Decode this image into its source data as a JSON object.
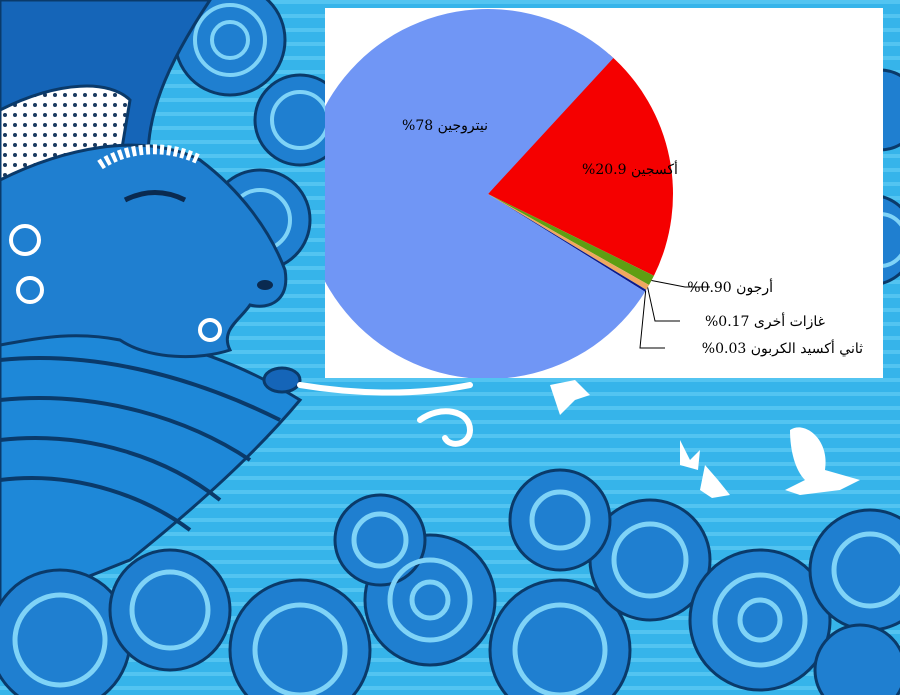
{
  "background": {
    "description_icon": "wind-god-blowing-over-waves-illustration",
    "colors": {
      "sky": "#2fa7e0",
      "deep": "#0b5fa8",
      "face": "#1f7fd0",
      "foam": "#ffffff"
    }
  },
  "chart_data": {
    "type": "pie",
    "title": "",
    "slices": [
      {
        "label": "نيتروجين 78%",
        "value": 78.0,
        "color": "#7096f5"
      },
      {
        "label": "أكسجين 20.9%",
        "value": 20.9,
        "color": "#f50000"
      },
      {
        "label": "أرجون 0.90%",
        "value": 0.9,
        "color": "#5f9e12"
      },
      {
        "label": "غازات أخرى 0.17%",
        "value": 0.17,
        "color": "#f0a860"
      },
      {
        "label": "ثاني أكسيد الكربون 0.03%",
        "value": 0.03,
        "color": "#0a1a8c"
      }
    ]
  }
}
